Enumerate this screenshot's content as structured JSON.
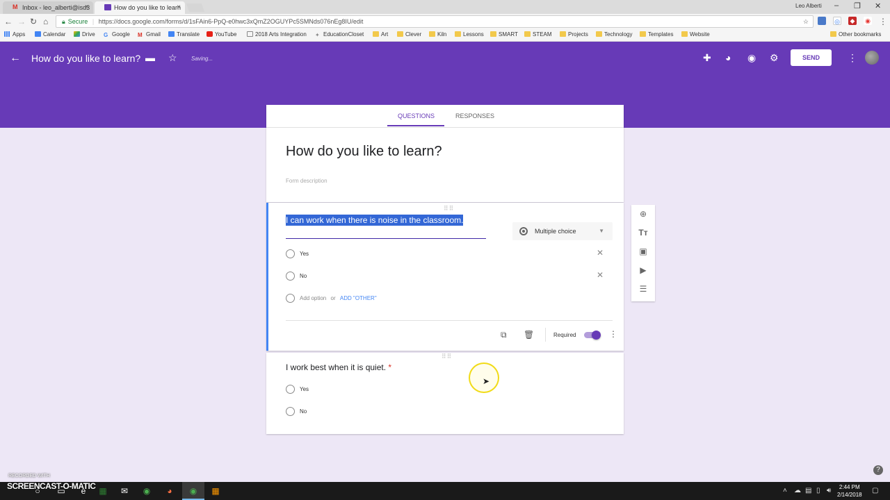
{
  "browser": {
    "tabs": [
      {
        "label": "Inbox - leo_alberti@isd3",
        "icon": "gmail-icon"
      },
      {
        "label": "How do you like to learn",
        "icon": "forms-icon"
      }
    ],
    "user_name": "Leo Alberti",
    "url_secure": "Secure",
    "url": "https://docs.google.com/forms/d/1sFAin6-PpQ-e0hwc3xQmZ2OGUYPc5SMNds076nEg8IU/edit",
    "bookmarks": [
      "Apps",
      "Calendar",
      "Drive",
      "Google",
      "Gmail",
      "Translate",
      "YouTube",
      "2018 Arts Integration",
      "EducationCloset",
      "Art",
      "Clever",
      "Kiln",
      "Lessons",
      "SMART",
      "STEAM",
      "Projects",
      "Technology",
      "Templates",
      "Website"
    ],
    "other_bookmarks": "Other bookmarks"
  },
  "header": {
    "title": "How do you like to learn?",
    "saving": "Saving...",
    "send_label": "SEND",
    "brand_color": "#673ab7"
  },
  "form_tabs": {
    "questions": "QUESTIONS",
    "responses": "RESPONSES"
  },
  "form": {
    "title": "How do you like to learn?",
    "description_placeholder": "Form description"
  },
  "question1": {
    "text": "I can work when there is noise in the classroom.",
    "type": "Multiple choice",
    "options": [
      "Yes",
      "No"
    ],
    "add_option": "Add option",
    "or": "or",
    "add_other": "ADD \"OTHER\"",
    "required_label": "Required",
    "required": true
  },
  "question2": {
    "text": "I work best when it is quiet.",
    "required_mark": "*",
    "options": [
      "Yes",
      "No"
    ]
  },
  "recording": {
    "recorded_with": "RECORDED WITH",
    "brand": "SCREENCAST-O-MATIC"
  },
  "taskbar": {
    "time": "2:44 PM",
    "date": "2/14/2018"
  }
}
